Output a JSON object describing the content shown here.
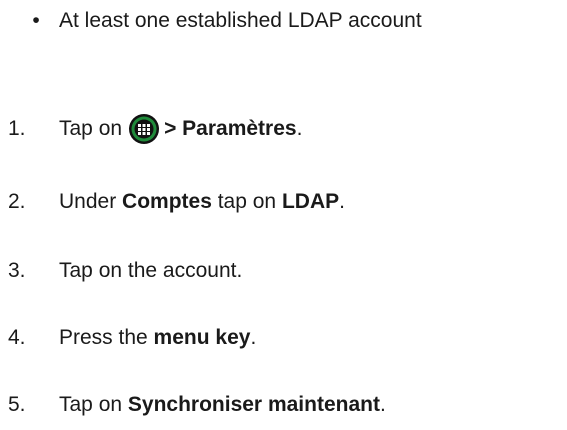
{
  "prerequisite": {
    "bullet": "•",
    "text": "At least one established LDAP account"
  },
  "steps": [
    {
      "number": "1.",
      "pre": "Tap on",
      "icon": "apps-grid-icon",
      "bold": "> Paramètres",
      "post": "."
    },
    {
      "number": "2.",
      "pre": "Under ",
      "bold1": "Comptes",
      "mid": " tap on ",
      "bold2": "LDAP",
      "post": "."
    },
    {
      "number": "3.",
      "text": "Tap on the account."
    },
    {
      "number": "4.",
      "pre": "Press the ",
      "bold": "menu key",
      "post": "."
    },
    {
      "number": "5.",
      "pre": "Tap on ",
      "bold": "Synchroniser maintenant",
      "post": "."
    }
  ],
  "colors": {
    "text": "#1a1a1a",
    "icon_fill": "#1f8a3a",
    "icon_ring": "#111111"
  }
}
